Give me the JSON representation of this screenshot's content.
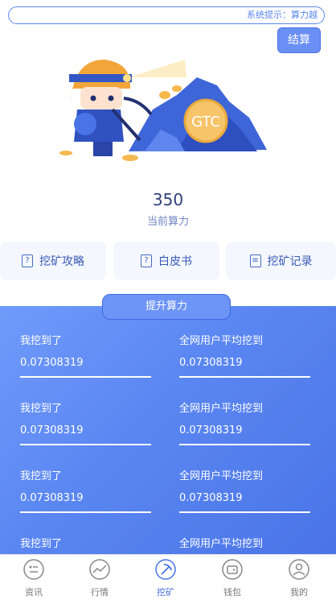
{
  "notice": {
    "text": "系统提示：算力越"
  },
  "settle_label": "结算",
  "illustration": {
    "coin_text": "GTC"
  },
  "power": {
    "value": "350",
    "label": "当前算力"
  },
  "quick_links": [
    {
      "label": "挖矿攻略",
      "icon": "question-icon"
    },
    {
      "label": "白皮书",
      "icon": "question-icon"
    },
    {
      "label": "挖矿记录",
      "icon": "list-icon"
    }
  ],
  "boost_label": "提升算力",
  "stats": [
    {
      "mine_label": "我挖到了",
      "mine_value": "0.07308319",
      "avg_label": "全网用户平均挖到",
      "avg_value": "0.07308319"
    },
    {
      "mine_label": "我挖到了",
      "mine_value": "0.07308319",
      "avg_label": "全网用户平均挖到",
      "avg_value": "0.07308319"
    },
    {
      "mine_label": "我挖到了",
      "mine_value": "0.07308319",
      "avg_label": "全网用户平均挖到",
      "avg_value": "0.07308319"
    },
    {
      "mine_label": "我挖到了",
      "mine_value": "",
      "avg_label": "全网用户平均挖到",
      "avg_value": ""
    }
  ],
  "nav": [
    {
      "label": "资讯",
      "icon": "news-icon",
      "active": false
    },
    {
      "label": "行情",
      "icon": "trend-icon",
      "active": false
    },
    {
      "label": "挖矿",
      "icon": "pickaxe-icon",
      "active": true
    },
    {
      "label": "钱包",
      "icon": "wallet-icon",
      "active": false
    },
    {
      "label": "我的",
      "icon": "user-icon",
      "active": false
    }
  ],
  "colors": {
    "accent": "#5a86f2",
    "nav_active": "#4a74e6",
    "text_dark": "#2d3f7a"
  }
}
